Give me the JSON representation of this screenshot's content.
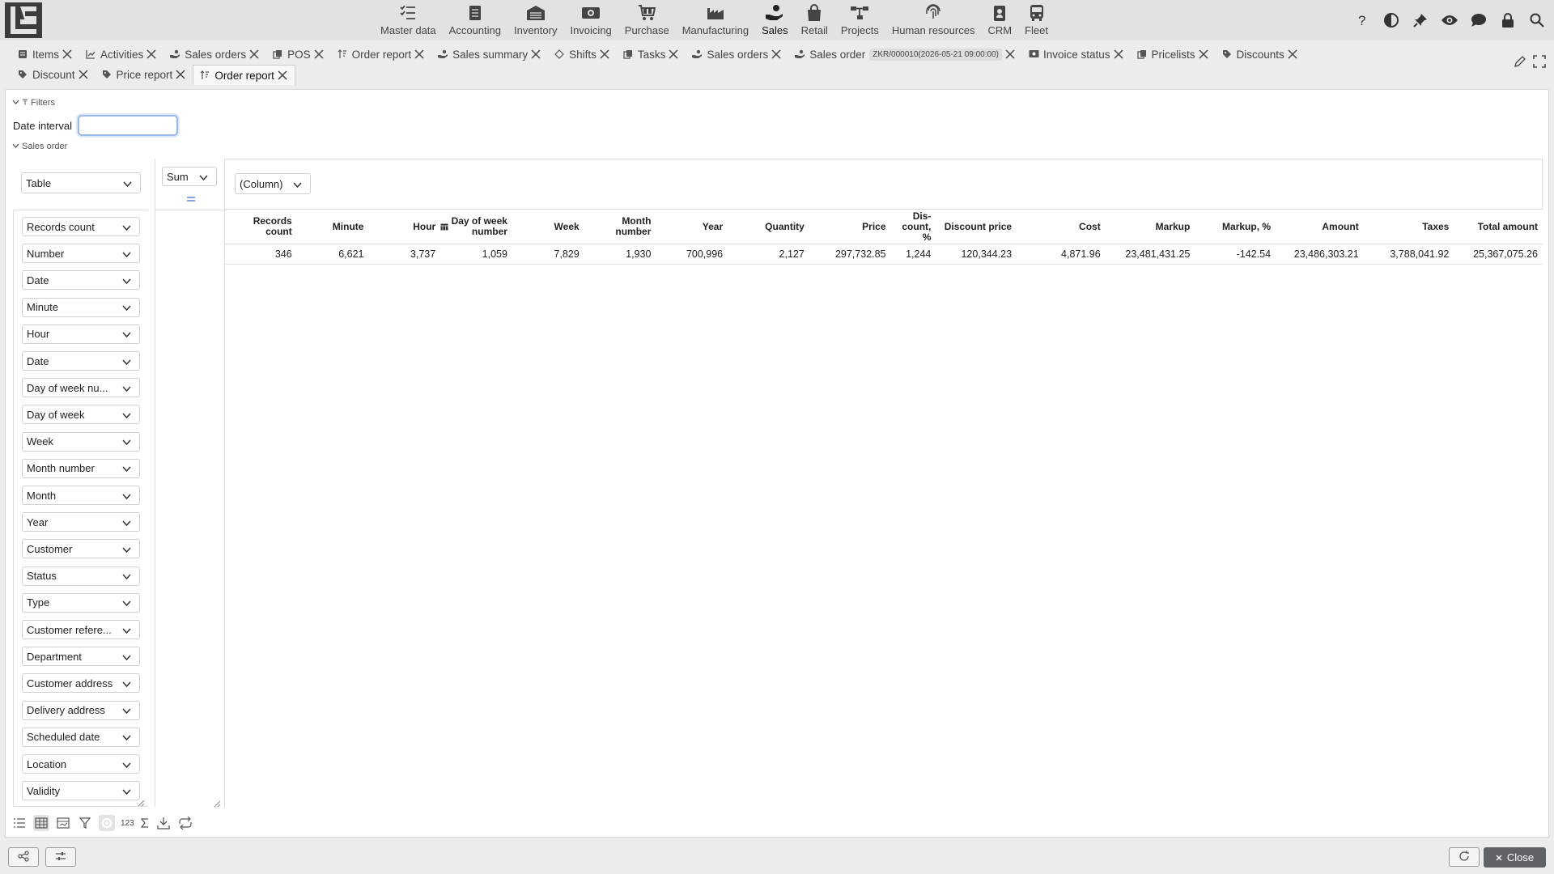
{
  "modules": [
    {
      "label": "Master data",
      "icon": "list-icon"
    },
    {
      "label": "Accounting",
      "icon": "notebook-icon"
    },
    {
      "label": "Inventory",
      "icon": "warehouse-icon"
    },
    {
      "label": "Invoicing",
      "icon": "cash-icon"
    },
    {
      "label": "Purchase",
      "icon": "cart-icon"
    },
    {
      "label": "Manufacturing",
      "icon": "factory-icon"
    },
    {
      "label": "Sales",
      "icon": "hand-coin-icon"
    },
    {
      "label": "Retail",
      "icon": "shopping-bag-icon"
    },
    {
      "label": "Projects",
      "icon": "network-icon"
    },
    {
      "label": "Human resources",
      "icon": "fingerprint-icon"
    },
    {
      "label": "CRM",
      "icon": "id-badge-icon"
    },
    {
      "label": "Fleet",
      "icon": "bus-icon"
    }
  ],
  "active_module": "Sales",
  "tabs_row1": [
    {
      "label": "Items"
    },
    {
      "label": "Activities"
    },
    {
      "label": "Sales orders"
    },
    {
      "label": "POS"
    },
    {
      "label": "Order report"
    },
    {
      "label": "Sales summary"
    },
    {
      "label": "Shifts"
    },
    {
      "label": "Tasks"
    },
    {
      "label": "Sales orders"
    },
    {
      "label": "Sales order",
      "badge": "ZKR/000010(2026-05-21 09:00:00)"
    },
    {
      "label": "Invoice status"
    },
    {
      "label": "Pricelists"
    },
    {
      "label": "Discounts"
    }
  ],
  "tabs_row2": [
    {
      "label": "Discount"
    },
    {
      "label": "Price report"
    },
    {
      "label": "Order report"
    }
  ],
  "filters": {
    "title": "Filters",
    "date_interval_label": "Date interval",
    "date_interval_value": "",
    "sales_order_title": "Sales order"
  },
  "pivot": {
    "view_select": "Table",
    "aggregate_select": "Sum",
    "column_select": "(Column)",
    "fields": [
      "Records count",
      "Number",
      "Date",
      "Minute",
      "Hour",
      "Date",
      "Day of week nu...",
      "Day of week",
      "Week",
      "Month number",
      "Month",
      "Year",
      "Customer",
      "Status",
      "Type",
      "Customer refere...",
      "Department",
      "Customer address",
      "Delivery address",
      "Scheduled date",
      "Location",
      "Validity"
    ],
    "headers": [
      "Records count",
      "Minute",
      "Hour",
      "Day of week number",
      "Week",
      "Month number",
      "Year",
      "Quantity",
      "Price",
      "Dis-count, %",
      "Discount price",
      "Cost",
      "Markup",
      "Markup, %",
      "Amount",
      "Taxes",
      "Total amount"
    ],
    "row": [
      "346",
      "6,621",
      "3,737",
      "1,059",
      "7,829",
      "1,930",
      "700,996",
      "2,127",
      "297,732.85",
      "1,244",
      "120,344.23",
      "4,871.96",
      "23,481,431.25",
      "-142.54",
      "23,486,303.21",
      "3,788,041.92",
      "25,367,075.26"
    ]
  },
  "bottom_tools": {
    "number_format_label": "123"
  },
  "footer": {
    "close_label": "Close"
  }
}
